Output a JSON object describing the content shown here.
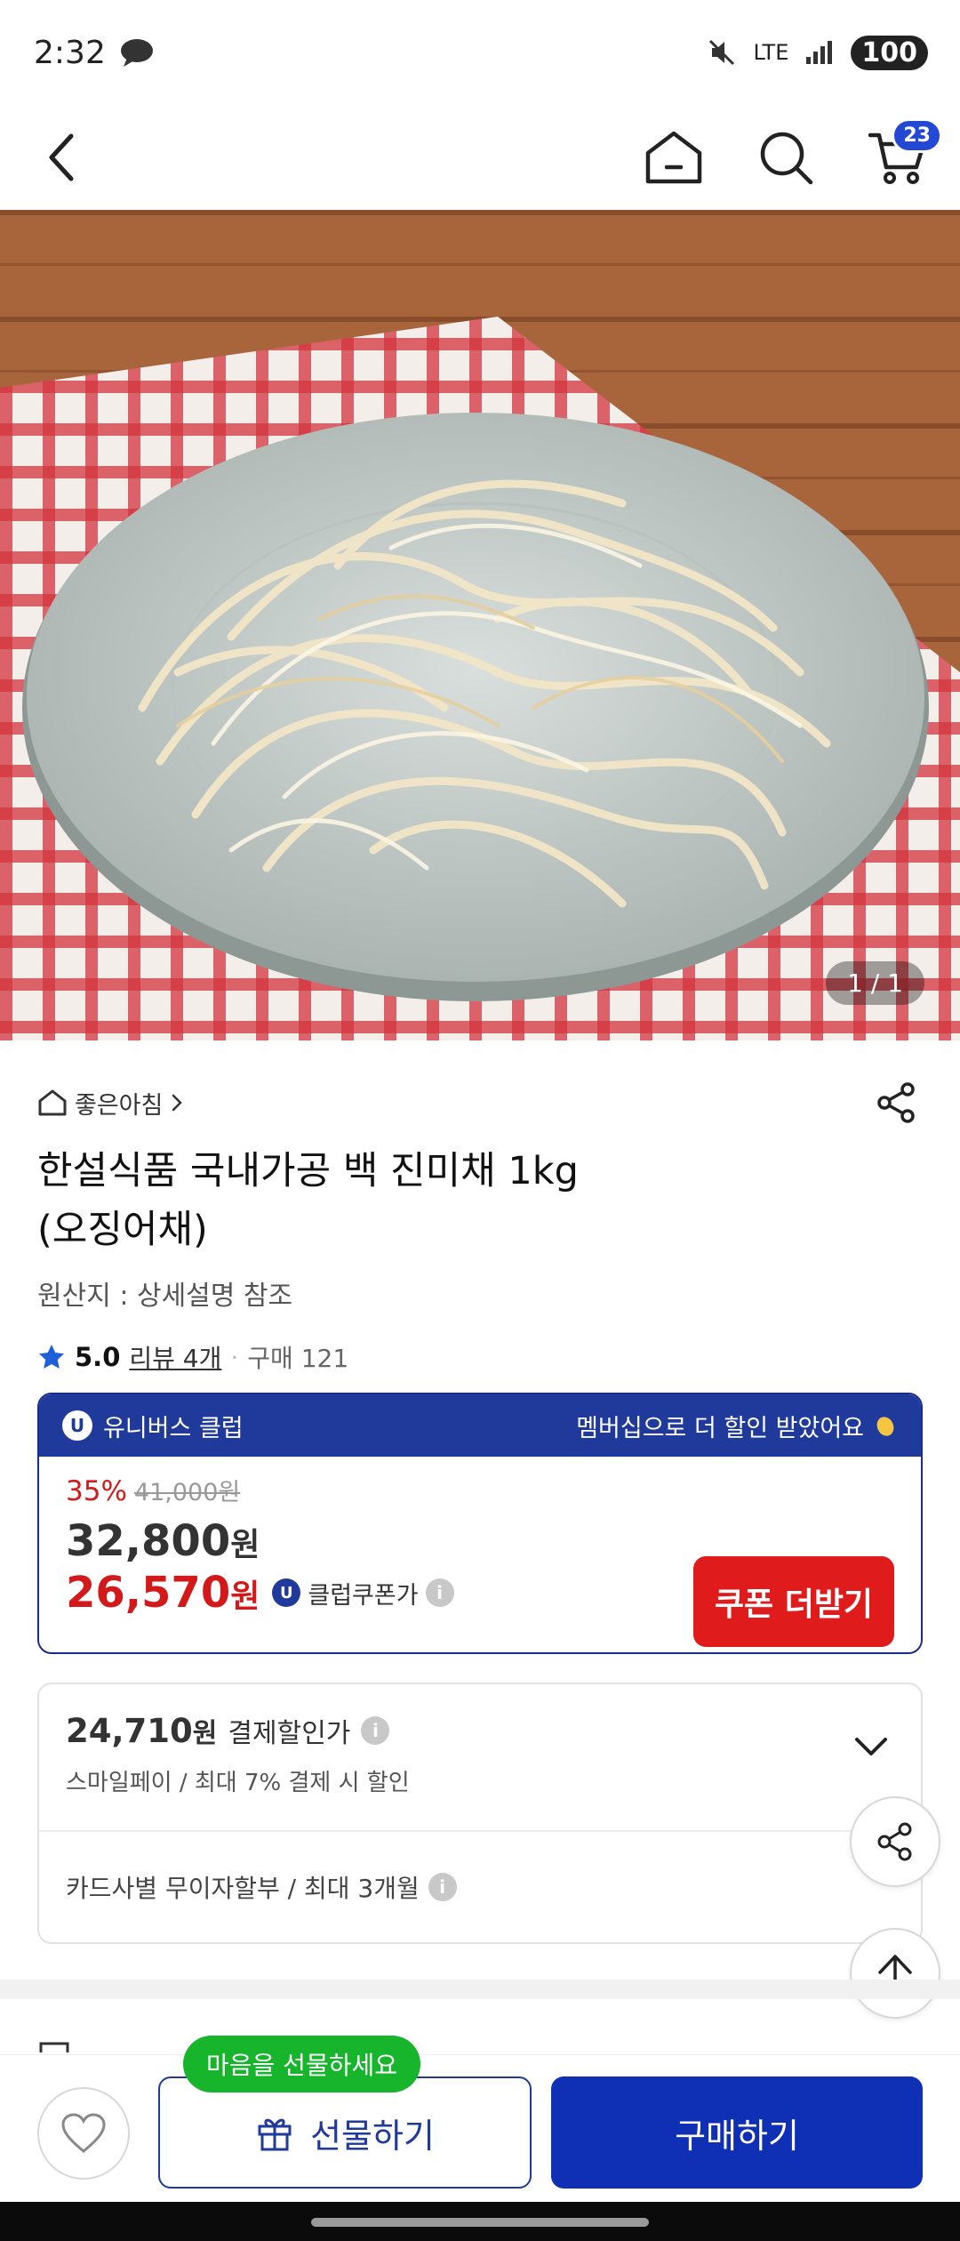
{
  "status_bar": {
    "time": "2:32",
    "network": "LTE",
    "battery": "100"
  },
  "header": {
    "cart_count": "23"
  },
  "gallery": {
    "page_indicator": "1 / 1"
  },
  "product": {
    "store_name": "좋은아침",
    "title_line1": "한설식품 국내가공 백 진미채 1kg",
    "title_line2": "(오징어채)",
    "origin": "원산지 : 상세설명 참조",
    "rating": "5.0",
    "review_link": "리뷰 4개",
    "purchase_count": "구매 121"
  },
  "club": {
    "name": "유니버스 클럽",
    "badge": "U",
    "membership_note": "멤버십으로 더 할인 받았어요",
    "discount_percent": "35%",
    "original_price": "41,000원",
    "sale_price": "32,800",
    "sale_currency": "원",
    "club_price": "26,570",
    "club_currency": "원",
    "club_coupon_label": "클럽쿠폰가",
    "coupon_button": "쿠폰 더받기"
  },
  "payment": {
    "price": "24,710",
    "currency": "원",
    "label": "결제할인가",
    "sub": "스마일페이 / 최대 7% 결제 시 할인",
    "installment": "카드사별 무이자할부 / 최대 3개월"
  },
  "bottom": {
    "gift_tooltip": "마음을 선물하세요",
    "gift_button": "선물하기",
    "buy_button": "구매하기"
  },
  "colors": {
    "brand_blue": "#1f3a9a",
    "buy_blue": "#0f2fb4",
    "sale_red": "#d31a1a",
    "coupon_red": "#e01b1b",
    "tooltip_green": "#16b52b"
  }
}
